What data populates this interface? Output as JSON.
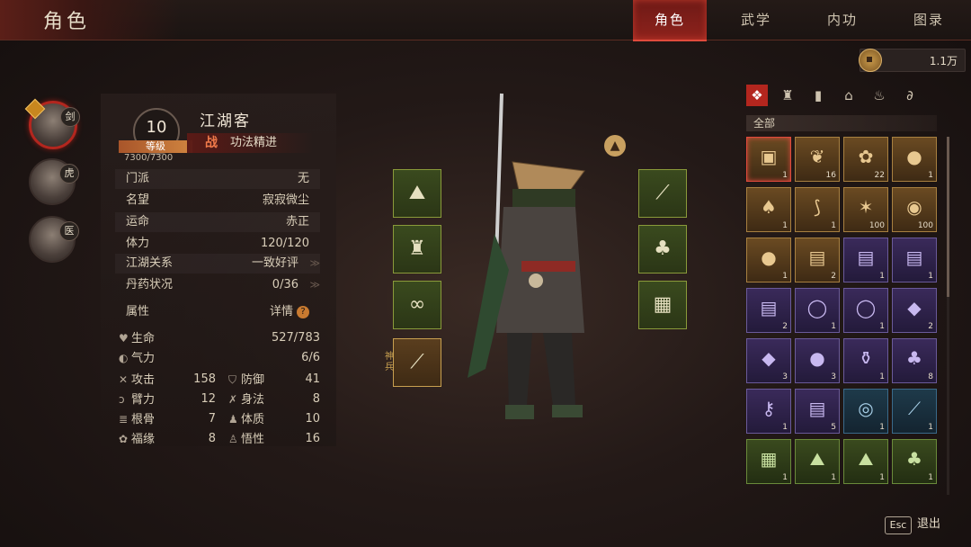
{
  "header": {
    "title": "角色",
    "tabs": [
      {
        "label": "角色",
        "active": true
      },
      {
        "label": "武学",
        "active": false
      },
      {
        "label": "内功",
        "active": false
      },
      {
        "label": "图录",
        "active": false
      }
    ]
  },
  "currency": {
    "icon": "coin-icon",
    "value": "1.1万"
  },
  "party": [
    {
      "badge": "剑",
      "marker": true,
      "active": true
    },
    {
      "badge": "虎",
      "marker": false,
      "active": false
    },
    {
      "badge": "医",
      "marker": false,
      "active": false
    }
  ],
  "character": {
    "level": "10",
    "level_label": "等级",
    "xp": "7300/7300",
    "xp_fraction": 1.0,
    "name": "江湖客",
    "tag_icon": "战",
    "tag_text": "功法精进",
    "info": [
      {
        "key": "门派",
        "value": "无",
        "arrow": false
      },
      {
        "key": "名望",
        "value": "寂寂微尘",
        "arrow": false
      },
      {
        "key": "运命",
        "value": "赤正",
        "arrow": false
      },
      {
        "key": "体力",
        "value": "120/120",
        "arrow": false
      },
      {
        "key": "江湖关系",
        "value": "一致好评",
        "arrow": true
      },
      {
        "key": "丹药状况",
        "value": "0/36",
        "arrow": true
      }
    ],
    "attr_title": "属性",
    "attr_detail": "详情",
    "vitals": [
      {
        "icon": "heart-icon",
        "label": "生命",
        "value": "527/783"
      },
      {
        "icon": "qi-icon",
        "label": "气力",
        "value": "6/6"
      }
    ],
    "stats": [
      {
        "icon": "sword-icon",
        "label": "攻击",
        "value": "158"
      },
      {
        "icon": "shield-icon",
        "label": "防御",
        "value": "41"
      },
      {
        "icon": "arm-icon",
        "label": "臂力",
        "value": "12"
      },
      {
        "icon": "movement-icon",
        "label": "身法",
        "value": "8"
      },
      {
        "icon": "bone-icon",
        "label": "根骨",
        "value": "7"
      },
      {
        "icon": "body-icon",
        "label": "体质",
        "value": "10"
      },
      {
        "icon": "fortune-icon",
        "label": "福缘",
        "value": "8"
      },
      {
        "icon": "insight-icon",
        "label": "悟性",
        "value": "16"
      }
    ]
  },
  "equipment": {
    "divine_weapon_label": "神兵"
  },
  "inventory": {
    "filter_label": "全部",
    "filters": [
      "all-filter-icon",
      "armor-filter-icon",
      "book-filter-icon",
      "hat-filter-icon",
      "herb-filter-icon",
      "misc-filter-icon"
    ],
    "items": [
      {
        "icon": "chest-icon",
        "count": "1",
        "rarity": "gold",
        "selected": true
      },
      {
        "icon": "herb-leaf-icon",
        "count": "16",
        "rarity": "gold"
      },
      {
        "icon": "flower-icon",
        "count": "22",
        "rarity": "gold"
      },
      {
        "icon": "potion-icon",
        "count": "1",
        "rarity": "gold"
      },
      {
        "icon": "mushroom-icon",
        "count": "1",
        "rarity": "gold"
      },
      {
        "icon": "root-icon",
        "count": "1",
        "rarity": "gold"
      },
      {
        "icon": "claw-icon",
        "count": "100",
        "rarity": "gold"
      },
      {
        "icon": "nest-icon",
        "count": "100",
        "rarity": "gold"
      },
      {
        "icon": "orb-icon",
        "count": "1",
        "rarity": "gold"
      },
      {
        "icon": "scroll-icon",
        "count": "2",
        "rarity": "gold"
      },
      {
        "icon": "scroll-icon",
        "count": "1",
        "rarity": "purple"
      },
      {
        "icon": "scroll-icon",
        "count": "1",
        "rarity": "purple"
      },
      {
        "icon": "scroll-icon",
        "count": "2",
        "rarity": "purple"
      },
      {
        "icon": "pearl-icon",
        "count": "1",
        "rarity": "purple"
      },
      {
        "icon": "pearl-icon",
        "count": "1",
        "rarity": "purple"
      },
      {
        "icon": "crystal-icon",
        "count": "2",
        "rarity": "purple"
      },
      {
        "icon": "jade-icon",
        "count": "3",
        "rarity": "purple"
      },
      {
        "icon": "amethyst-icon",
        "count": "3",
        "rarity": "purple"
      },
      {
        "icon": "vase-icon",
        "count": "1",
        "rarity": "purple"
      },
      {
        "icon": "gourd-icon",
        "count": "8",
        "rarity": "purple"
      },
      {
        "icon": "key-icon",
        "count": "1",
        "rarity": "purple"
      },
      {
        "icon": "scroll-icon",
        "count": "5",
        "rarity": "purple"
      },
      {
        "icon": "ring-icon",
        "count": "1",
        "rarity": "blue"
      },
      {
        "icon": "feather-icon",
        "count": "1",
        "rarity": "blue"
      },
      {
        "icon": "bracer-icon",
        "count": "1",
        "rarity": "green"
      },
      {
        "icon": "straw-hat-icon",
        "count": "1",
        "rarity": "green"
      },
      {
        "icon": "straw-hat-icon",
        "count": "1",
        "rarity": "green"
      },
      {
        "icon": "armor-icon",
        "count": "1",
        "rarity": "green"
      }
    ]
  },
  "footer": {
    "esc": "Esc",
    "exit": "退出"
  }
}
